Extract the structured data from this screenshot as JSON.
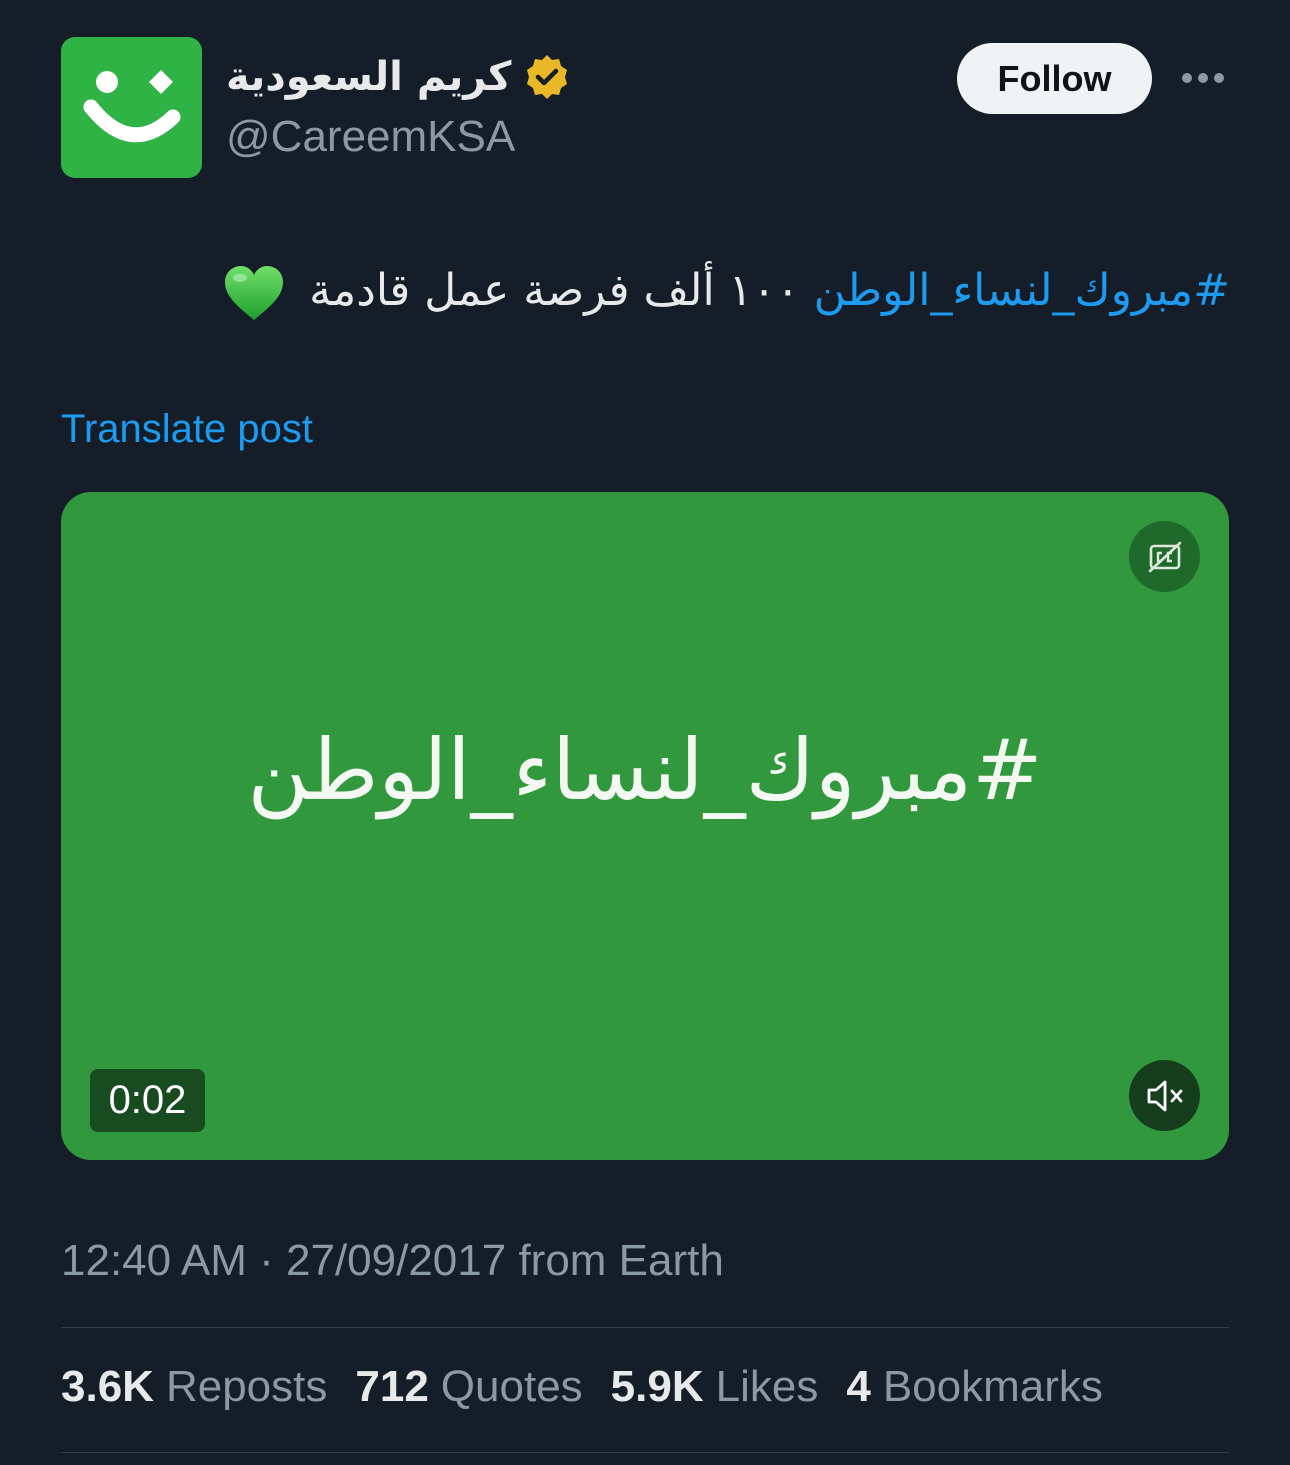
{
  "account": {
    "display_name": "كريم السعودية",
    "handle": "@CareemKSA",
    "avatar_icon": "careem-smile-logo",
    "verified_icon": "verified-badge-gold-icon",
    "brand_color": "#2fb344"
  },
  "actions": {
    "follow_label": "Follow",
    "more_icon": "more-dots-icon"
  },
  "tweet": {
    "hashtag": "#مبروك_لنساء_الوطن",
    "text": "١٠٠ ألف فرصة عمل قادمة",
    "emoji_icon": "green-heart-icon",
    "translate_label": "Translate post"
  },
  "media": {
    "overlay_text": "#مبروك_لنساء_الوطن",
    "duration": "0:02",
    "captions_icon": "captions-off-icon",
    "mute_icon": "muted-speaker-icon",
    "background_color": "#31983e"
  },
  "meta": {
    "timestamp": "12:40 AM · 27/09/2017 from Earth"
  },
  "stats": [
    {
      "value": "3.6K",
      "label": "Reposts"
    },
    {
      "value": "712",
      "label": "Quotes"
    },
    {
      "value": "5.9K",
      "label": "Likes"
    },
    {
      "value": "4",
      "label": "Bookmarks"
    }
  ],
  "colors": {
    "background": "#151d28",
    "link": "#1d9bf0",
    "secondary_text": "#8b98a5",
    "primary_text": "#e7e9ea"
  }
}
